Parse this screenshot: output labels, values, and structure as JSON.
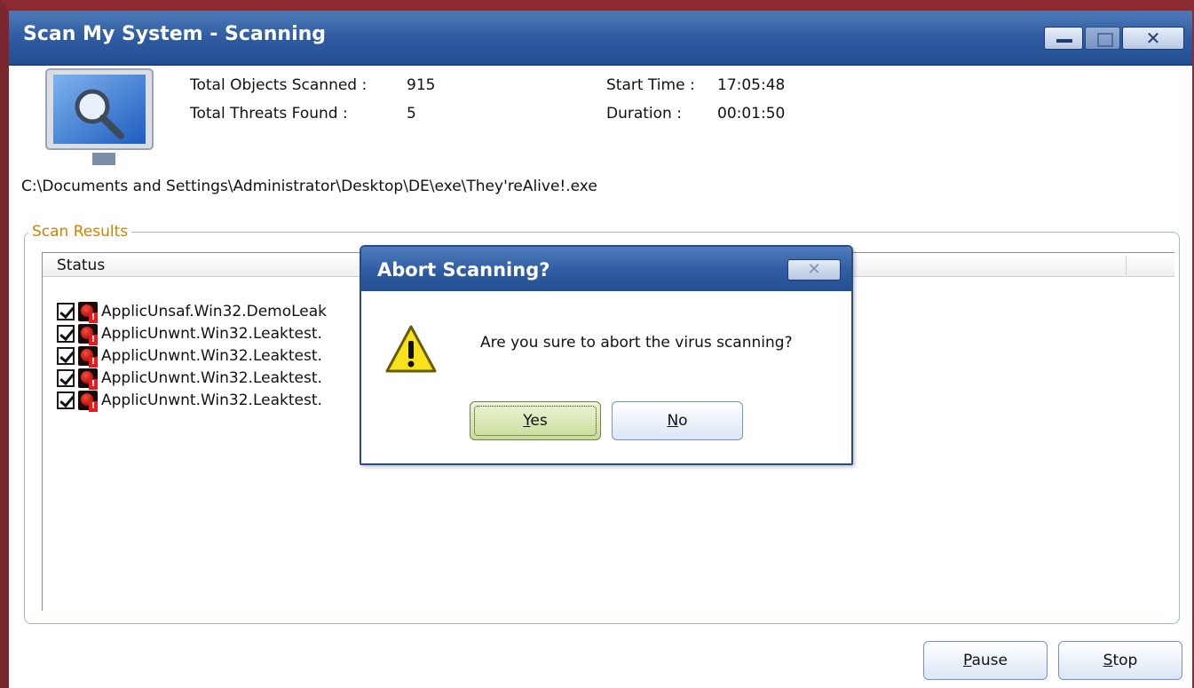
{
  "window": {
    "title": "Scan My System - Scanning",
    "close_glyph": "✕"
  },
  "stats": {
    "objects_label": "Total Objects Scanned :",
    "objects_value": "915",
    "threats_label": "Total Threats Found :",
    "threats_value": "5",
    "start_label": "Start Time :",
    "start_value": "17:05:48",
    "duration_label": "Duration :",
    "duration_value": "00:01:50"
  },
  "current_path": "C:\\Documents and Settings\\Administrator\\Desktop\\DE\\exe\\They'reAlive!.exe",
  "results": {
    "legend": "Scan Results",
    "column_status": "Status",
    "rows": [
      {
        "name": "ApplicUnsaf.Win32.DemoLeak",
        "checked": true
      },
      {
        "name": "ApplicUnwnt.Win32.Leaktest.",
        "checked": true
      },
      {
        "name": "ApplicUnwnt.Win32.Leaktest.",
        "checked": true
      },
      {
        "name": "ApplicUnwnt.Win32.Leaktest.",
        "checked": true
      },
      {
        "name": "ApplicUnwnt.Win32.Leaktest.",
        "checked": true
      }
    ]
  },
  "buttons": {
    "pause_mnemonic": "P",
    "pause_rest": "ause",
    "stop_mnemonic": "S",
    "stop_rest": "top"
  },
  "dialog": {
    "title": "Abort Scanning?",
    "close_glyph": "✕",
    "message": "Are you sure to abort the virus scanning?",
    "yes_mnemonic": "Y",
    "yes_rest": "es",
    "no_mnemonic": "N",
    "no_rest": "o"
  },
  "colors": {
    "titlebar": "#2d5aa0",
    "legend": "#d08000",
    "border_accent": "#8c2a32"
  }
}
